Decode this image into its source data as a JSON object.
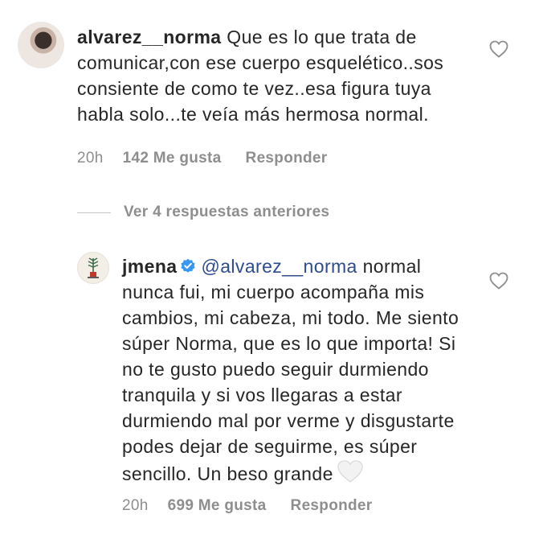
{
  "main_comment": {
    "avatar_icon": "profile-photo-avatar",
    "username": "alvarez__norma",
    "text": "Que es lo que trata de comunicar,con ese cuerpo esquelético..sos consiente de como te vez..esa figura tuya habla solo...te veía más hermosa normal.",
    "time": "20h",
    "likes": "142 Me gusta",
    "reply_label": "Responder",
    "like_icon": "heart-outline-icon"
  },
  "view_replies": {
    "label": "Ver 4 respuestas anteriores"
  },
  "reply_comment": {
    "avatar_icon": "plant-logo-avatar",
    "username": "jmena",
    "verified_icon": "verified-badge-icon",
    "mention": "@alvarez__norma",
    "text": "normal nunca fui, mi cuerpo acompaña mis cambios, mi cabeza, mi todo. Me siento súper Norma, que es lo que importa! Si no te gusto puedo seguir durmiendo tranquila y si vos llegaras a estar durmiendo mal por verme y disgustarte podes dejar de seguirme, es súper sencillo. Un beso grande",
    "emoji_icon": "white-heart-emoji",
    "time": "20h",
    "likes": "699 Me gusta",
    "reply_label": "Responder",
    "like_icon": "heart-outline-icon"
  },
  "colors": {
    "text": "#262626",
    "muted": "#8e8e8e",
    "mention": "#2e4b8f",
    "verified": "#3897f0"
  }
}
